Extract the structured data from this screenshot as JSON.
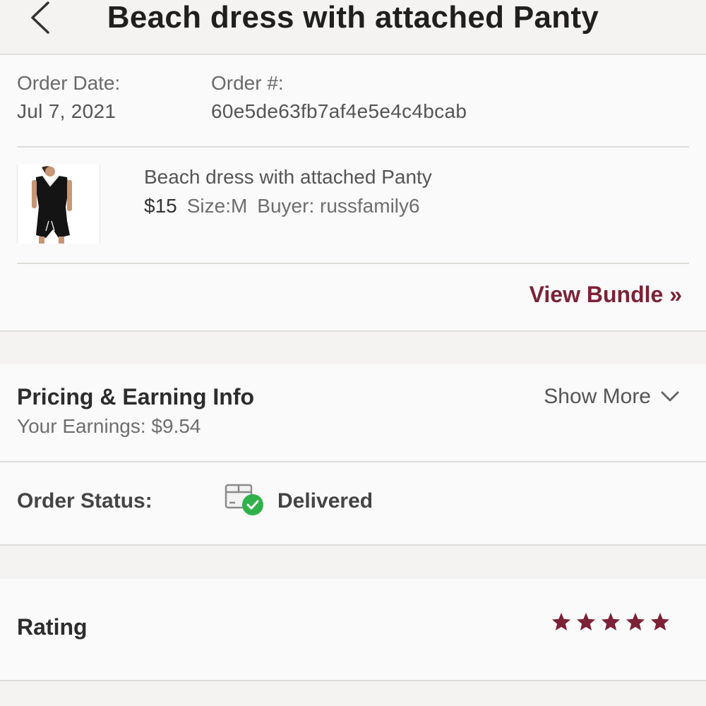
{
  "header": {
    "title": "Beach dress with attached Panty"
  },
  "order": {
    "date_label": "Order Date:",
    "date_value": "Jul 7, 2021",
    "number_label": "Order #:",
    "number_value": "60e5de63fb7af4e5e4c4bcab"
  },
  "item": {
    "title": "Beach dress with attached Panty",
    "price": "$15",
    "size": "Size:M",
    "buyer": "Buyer: russfamily6",
    "image": "black-romper-photo"
  },
  "bundle": {
    "label": "View Bundle »"
  },
  "pricing": {
    "title": "Pricing & Earning Info",
    "earnings": "Your Earnings: $9.54",
    "show_more": "Show More"
  },
  "status": {
    "label": "Order Status:",
    "value": "Delivered",
    "icon": "delivered-box-check-icon"
  },
  "rating": {
    "label": "Rating",
    "stars": 5,
    "max_stars": 5,
    "star_color": "#7b2236"
  },
  "colors": {
    "accent": "#7b2236",
    "check_green": "#2fb24a"
  }
}
